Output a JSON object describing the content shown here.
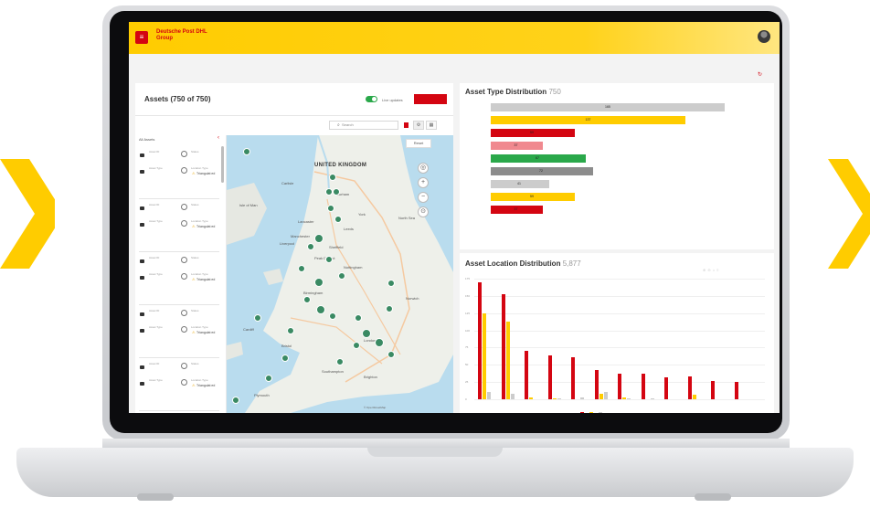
{
  "header": {
    "menu_icon": "hamburger-icon",
    "brand": "Deutsche Post DHL Group",
    "app_name": "",
    "avatar_icon": "user-avatar-icon",
    "brand_colors": {
      "yellow": "#ffcc00",
      "red": "#d40511"
    }
  },
  "breadcrumb": "",
  "last_updated": "",
  "assets_panel": {
    "title": "Assets (750 of 750)",
    "sync_text": "",
    "live_updates_label": "Live updates",
    "live_updates_on": true,
    "export_label": "",
    "search_placeholder": "Search",
    "list_header": "All Assets",
    "sort_label": "",
    "cards": [
      {
        "id_label": "Asset ID",
        "status_label": "Status",
        "type_label": "Asset Type",
        "location_label": "Location Type",
        "location_value": "Triangulat ed",
        "footer": ""
      },
      {
        "id_label": "Asset ID",
        "status_label": "Status",
        "type_label": "Asset Type",
        "location_label": "Location Type",
        "location_value": "Triangulat ed",
        "footer": ""
      },
      {
        "id_label": "Asset ID",
        "status_label": "Status",
        "type_label": "Asset Type",
        "location_label": "Location Type",
        "location_value": "Triangulat ed",
        "footer": ""
      },
      {
        "id_label": "Asset ID",
        "status_label": "Status",
        "type_label": "Asset Type",
        "location_label": "Location Type",
        "location_value": "Triangulat ed",
        "footer": ""
      },
      {
        "id_label": "Asset ID",
        "status_label": "Status",
        "type_label": "Asset Type",
        "location_label": "Location Type",
        "location_value": "Triangulat ed",
        "footer": ""
      }
    ]
  },
  "map": {
    "reset_label": "Reset",
    "labels": {
      "uk": "UNITED KINGDOM",
      "carlisle": "Carlisle",
      "durham": "Durham",
      "isle_of_man": "Isle of Man",
      "lancaster": "Lancaster",
      "york": "York",
      "leeds": "Leeds",
      "manchester": "Manchester",
      "sheffield": "Sheffield",
      "liverpool": "Liverpool",
      "nottingham": "Nottingham",
      "birmingham": "Birmingham",
      "cardiff": "Cardiff",
      "london": "London",
      "bristol": "Bristol",
      "southampton": "Southampton",
      "brighton": "Brighton",
      "plymouth": "Plymouth",
      "norwich": "Norwich",
      "peak_district": "Peak District",
      "north_sea": "North Sea"
    },
    "controls": [
      "locate-icon",
      "zoom-in-icon",
      "zoom-out-icon",
      "layers-icon"
    ],
    "pin_color": "#3a8a63"
  },
  "type_distribution": {
    "title": "Asset Type Distribution",
    "total": "750"
  },
  "location_distribution": {
    "title": "Asset Location Distribution",
    "total": "5,877"
  },
  "chart_data": [
    {
      "type": "bar",
      "orientation": "horizontal",
      "title": "Asset Type Distribution 750",
      "categories": [
        "",
        "",
        "",
        "",
        "",
        "",
        "",
        "",
        ""
      ],
      "values": [
        165,
        137,
        59,
        37,
        67,
        72,
        41,
        59,
        37
      ],
      "colors": [
        "#cccccc",
        "#ffcc00",
        "#d40511",
        "#f0898f",
        "#2aa84a",
        "#8c8c8c",
        "#cccccc",
        "#ffcc00",
        "#d40511"
      ],
      "xlim": [
        0,
        165
      ]
    },
    {
      "type": "bar",
      "title": "Asset Location Distribution 5,877",
      "categories": [
        "",
        "",
        "",
        "",
        "",
        "",
        "",
        "",
        "",
        "",
        "",
        ""
      ],
      "series": [
        {
          "name": "",
          "color": "#d40511",
          "values": [
            170,
            152,
            70,
            63,
            61,
            43,
            37,
            37,
            32,
            33,
            27,
            25
          ]
        },
        {
          "name": "",
          "color": "#ffcc00",
          "values": [
            125,
            113,
            3,
            1,
            0,
            8,
            2,
            0,
            0,
            7,
            0,
            0
          ]
        },
        {
          "name": "",
          "color": "#cccccc",
          "values": [
            10,
            8,
            0,
            1,
            2,
            11,
            1,
            1,
            0,
            0,
            0,
            0
          ]
        }
      ],
      "ylim": [
        0,
        175
      ],
      "grid": true,
      "legend": "bottom"
    }
  ]
}
